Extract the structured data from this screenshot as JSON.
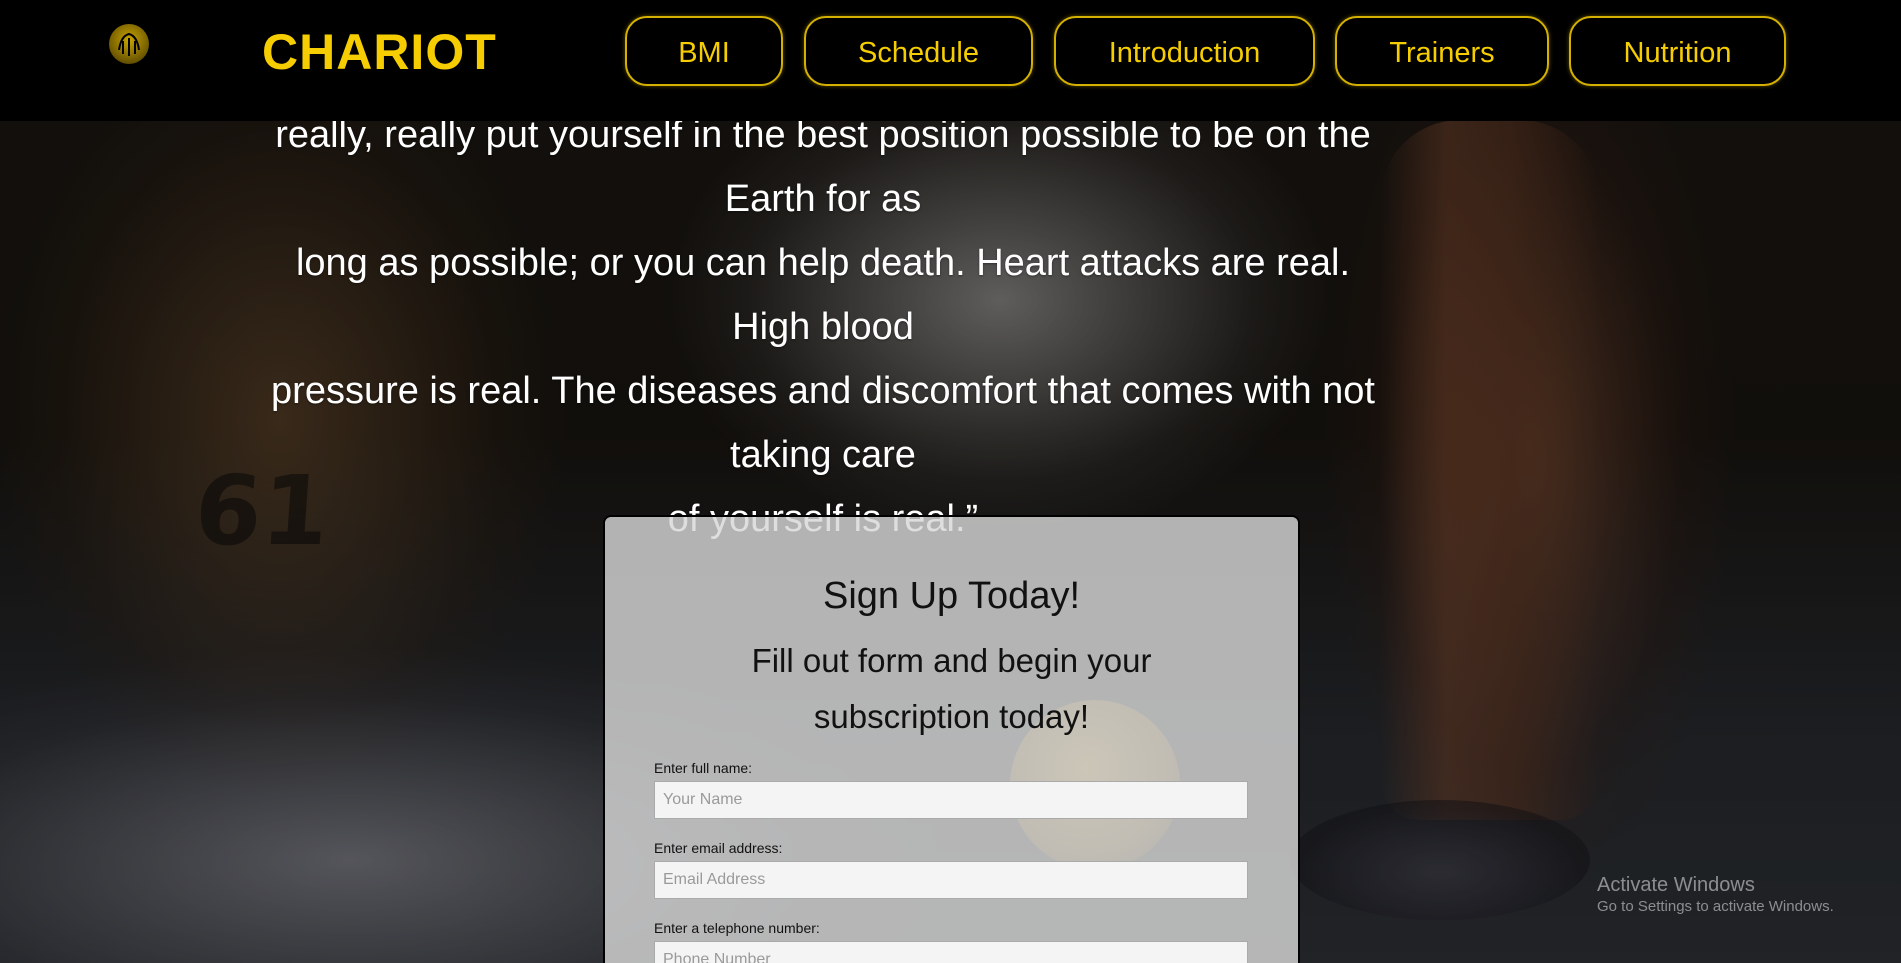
{
  "header": {
    "brand": "CHARIOT",
    "brand_color": "#f5cd00",
    "logo_icon": "chariot-logo-icon",
    "nav": [
      {
        "label": "BMI"
      },
      {
        "label": "Schedule"
      },
      {
        "label": "Introduction"
      },
      {
        "label": "Trainers"
      },
      {
        "label": "Nutrition"
      }
    ]
  },
  "hero": {
    "quote_lines": [
      "really, really put yourself in the best position possible to be on the Earth for as",
      "long as possible; or you can help death. Heart attacks are real. High blood",
      "pressure is real. The diseases and discomfort that comes with not taking care",
      "of yourself is real.”"
    ]
  },
  "signup": {
    "title": "Sign Up Today!",
    "subtitle": "Fill out form and begin your subscription today!",
    "fields": [
      {
        "label": "Enter full name:",
        "placeholder": "Your Name"
      },
      {
        "label": "Enter email address:",
        "placeholder": "Email Address"
      },
      {
        "label": "Enter a telephone number:",
        "placeholder": "Phone Number"
      }
    ]
  },
  "watermark": {
    "title": "Activate Windows",
    "subtitle": "Go to Settings to activate Windows."
  }
}
